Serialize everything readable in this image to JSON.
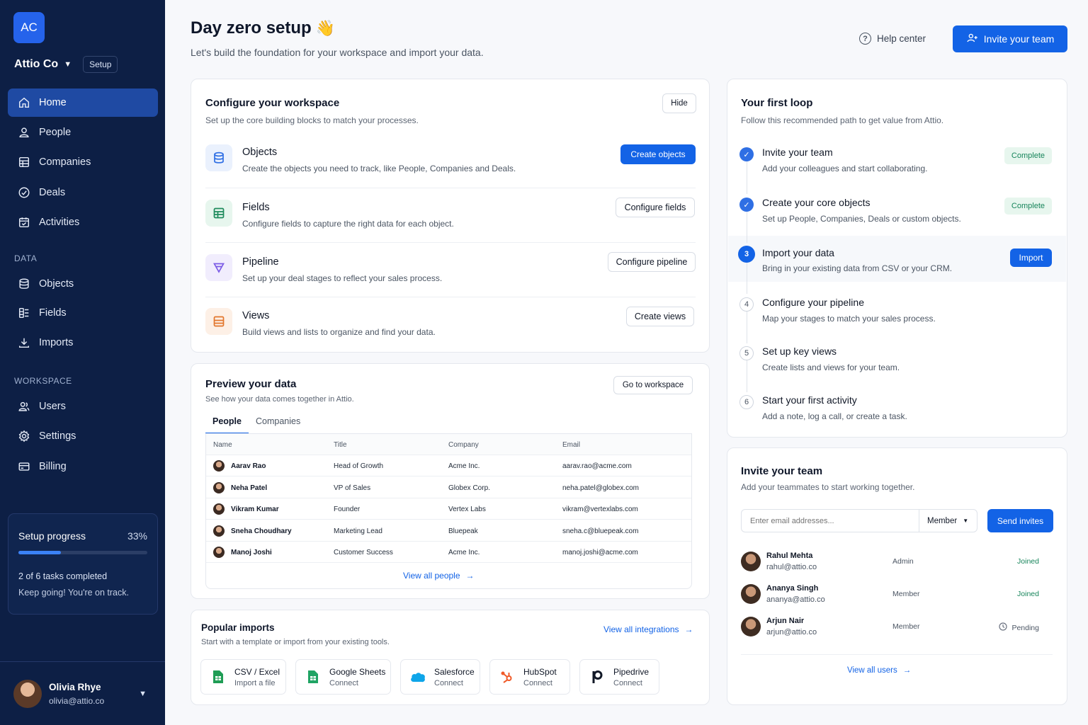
{
  "colors": {
    "sidebar_bg": "#0d1f45",
    "accent": "#1363e6",
    "success": "#17855b"
  },
  "sidebar": {
    "logo_text": "AC",
    "workspace_name": "Attio Co",
    "workspace_badge": "Setup",
    "main_items": [
      {
        "label": "Home",
        "icon": "home-icon",
        "active": true
      },
      {
        "label": "People",
        "icon": "person-icon"
      },
      {
        "label": "Companies",
        "icon": "building-icon"
      },
      {
        "label": "Deals",
        "icon": "check-circle-icon"
      },
      {
        "label": "Activities",
        "icon": "calendar-icon"
      }
    ],
    "data_section": "DATA",
    "data_items": [
      {
        "label": "Objects",
        "icon": "database-icon"
      },
      {
        "label": "Fields",
        "icon": "fields-icon"
      },
      {
        "label": "Imports",
        "icon": "download-icon"
      }
    ],
    "workspace_section": "WORKSPACE",
    "workspace_items": [
      {
        "label": "Users",
        "icon": "users-icon"
      },
      {
        "label": "Settings",
        "icon": "gear-icon"
      },
      {
        "label": "Billing",
        "icon": "card-icon"
      }
    ],
    "progress": {
      "title": "Setup progress",
      "percent_label": "33%",
      "percent": 33,
      "tasks": "2 of 6 tasks completed",
      "encouragement": "Keep going! You're on track."
    },
    "user": {
      "name": "Olivia Rhye",
      "email": "olivia@attio.co"
    }
  },
  "header": {
    "title": "Day zero setup",
    "emoji": "👋",
    "subtitle": "Let's build the foundation for your workspace and import your data.",
    "help": "Help center",
    "invite": "Invite your team"
  },
  "configure": {
    "title": "Configure your workspace",
    "subtitle": "Set up the core building blocks to match your processes.",
    "hide": "Hide",
    "items": [
      {
        "title": "Objects",
        "desc": "Create the objects you need to track, like People, Companies and Deals.",
        "action": "Create objects"
      },
      {
        "title": "Fields",
        "desc": "Configure fields to capture the right data for each object.",
        "action": "Configure fields"
      },
      {
        "title": "Pipeline",
        "desc": "Set up your deal stages to reflect your sales process.",
        "action": "Configure pipeline"
      },
      {
        "title": "Views",
        "desc": "Build views and lists to organize and find your data.",
        "action": "Create views"
      }
    ]
  },
  "preview": {
    "title": "Preview your data",
    "subtitle": "See how your data comes together in Attio.",
    "go": "Go to workspace",
    "tabs": [
      "People",
      "Companies"
    ],
    "columns": [
      "Name",
      "Title",
      "Company",
      "Email"
    ],
    "rows": [
      [
        "Aarav Rao",
        "Head of Growth",
        "Acme Inc.",
        "aarav.rao@acme.com"
      ],
      [
        "Neha Patel",
        "VP of Sales",
        "Globex Corp.",
        "neha.patel@globex.com"
      ],
      [
        "Vikram Kumar",
        "Founder",
        "Vertex Labs",
        "vikram@vertexlabs.com"
      ],
      [
        "Sneha Choudhary",
        "Marketing Lead",
        "Bluepeak",
        "sneha.c@bluepeak.com"
      ],
      [
        "Manoj Joshi",
        "Customer Success",
        "Acme Inc.",
        "manoj.joshi@acme.com"
      ]
    ],
    "view_all": "View all people"
  },
  "imports": {
    "title": "Popular imports",
    "subtitle": "Start with a template or import from your existing tools.",
    "view_all": "View all integrations",
    "items": [
      {
        "name": "CSV / Excel",
        "sub": "Import a file",
        "icon": "sheet-icon"
      },
      {
        "name": "Google Sheets",
        "sub": "Connect",
        "icon": "google-sheets-icon"
      },
      {
        "name": "Salesforce",
        "sub": "Connect",
        "icon": "salesforce-icon"
      },
      {
        "name": "HubSpot",
        "sub": "Connect",
        "icon": "hubspot-icon"
      },
      {
        "name": "Pipedrive",
        "sub": "Connect",
        "icon": "pipedrive-icon"
      }
    ]
  },
  "loop": {
    "title": "Your first loop",
    "subtitle": "Follow this recommended path to get value from Attio.",
    "steps": [
      {
        "marker": "✓",
        "title": "Invite your team",
        "desc": "Add your colleagues and start collaborating.",
        "status": "Complete"
      },
      {
        "marker": "✓",
        "title": "Create your core objects",
        "desc": "Set up People, Companies, Deals or custom objects.",
        "status": "Complete"
      },
      {
        "marker": "3",
        "title": "Import your data",
        "desc": "Bring in your existing data from CSV or your CRM.",
        "action": "Import"
      },
      {
        "marker": "4",
        "title": "Configure your pipeline",
        "desc": "Map your stages to match your sales process."
      },
      {
        "marker": "5",
        "title": "Set up key views",
        "desc": "Create lists and views for your team."
      },
      {
        "marker": "6",
        "title": "Start your first activity",
        "desc": "Add a note, log a call, or create a task."
      }
    ]
  },
  "invite": {
    "title": "Invite your team",
    "subtitle": "Add your teammates to start working together.",
    "placeholder": "Enter email addresses...",
    "role": "Member",
    "send": "Send invites",
    "members": [
      {
        "name": "Rahul Mehta",
        "email": "rahul@attio.co",
        "role": "Admin",
        "status": "Joined"
      },
      {
        "name": "Ananya Singh",
        "email": "ananya@attio.co",
        "role": "Member",
        "status": "Joined"
      },
      {
        "name": "Arjun Nair",
        "email": "arjun@attio.co",
        "role": "Member",
        "status": "Pending"
      }
    ],
    "view_all": "View all users"
  }
}
